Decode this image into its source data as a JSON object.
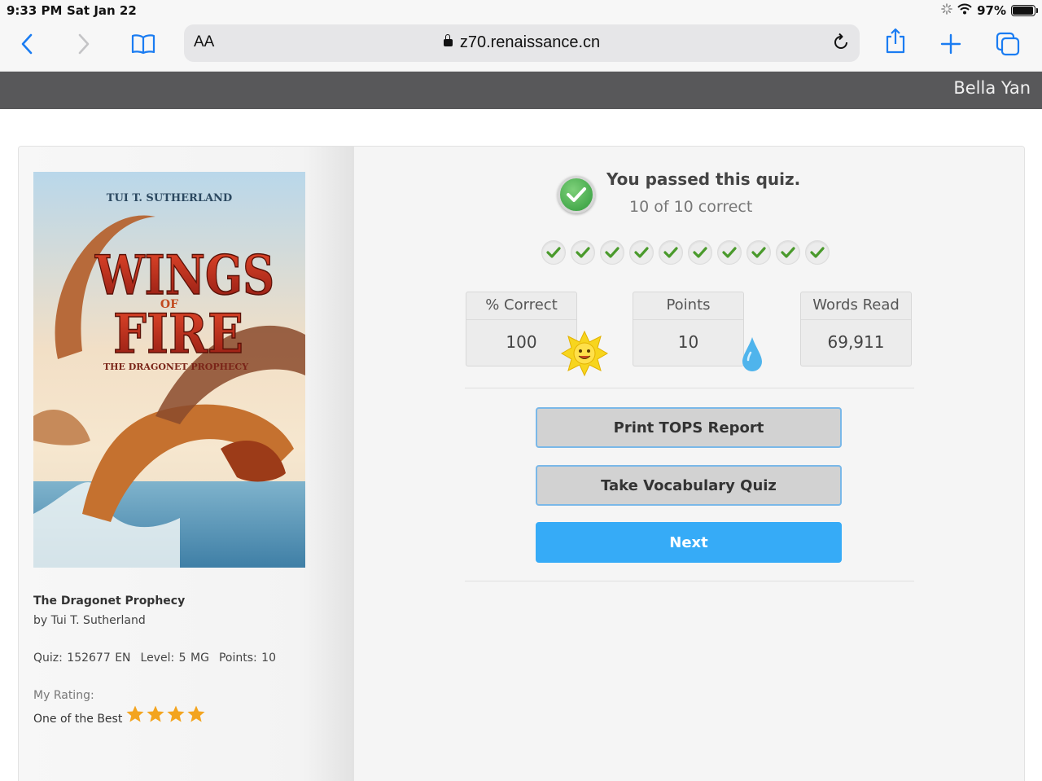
{
  "status_bar": {
    "time": "9:33 PM",
    "date": "Sat Jan 22",
    "battery": "97%",
    "battery_level": 0.97
  },
  "browser": {
    "text_size_label": "AA",
    "url": "z70.renaissance.cn",
    "icons": [
      "back-icon",
      "forward-icon",
      "bookmarks-icon",
      "lock-icon",
      "reload-icon",
      "share-icon",
      "new-tab-icon",
      "tabs-icon"
    ]
  },
  "header": {
    "user_name": "Bella Yan"
  },
  "book": {
    "cover": {
      "author": "TUI T. SUTHERLAND",
      "title_line1": "WINGS",
      "title_of": "OF",
      "title_line2": "FIRE",
      "subtitle": "THE DRAGONET PROPHECY"
    },
    "title": "The Dragonet Prophecy",
    "author_line": "by Tui T. Sutherland",
    "quiz": "Quiz: 152677 EN",
    "level": "Level: 5 MG",
    "points": "Points: 10",
    "rating_label": "My Rating:",
    "rating_value": "One of the Best",
    "rating_stars": 4
  },
  "result": {
    "title": "You passed this quiz.",
    "subtitle": "10 of 10 correct",
    "questions_correct": [
      true,
      true,
      true,
      true,
      true,
      true,
      true,
      true,
      true,
      true
    ]
  },
  "stats": [
    {
      "label": "% Correct",
      "value": "100"
    },
    {
      "label": "Points",
      "value": "10"
    },
    {
      "label": "Words Read",
      "value": "69,911"
    }
  ],
  "buttons": {
    "print": "Print TOPS Report",
    "vocab": "Take Vocabulary Quiz",
    "next": "Next"
  },
  "colors": {
    "header": "#58585a",
    "next_button": "#36abf7",
    "check_green": "#4a9a2c",
    "star": "#f3a41f",
    "safari_blue": "#1a7cf2"
  }
}
